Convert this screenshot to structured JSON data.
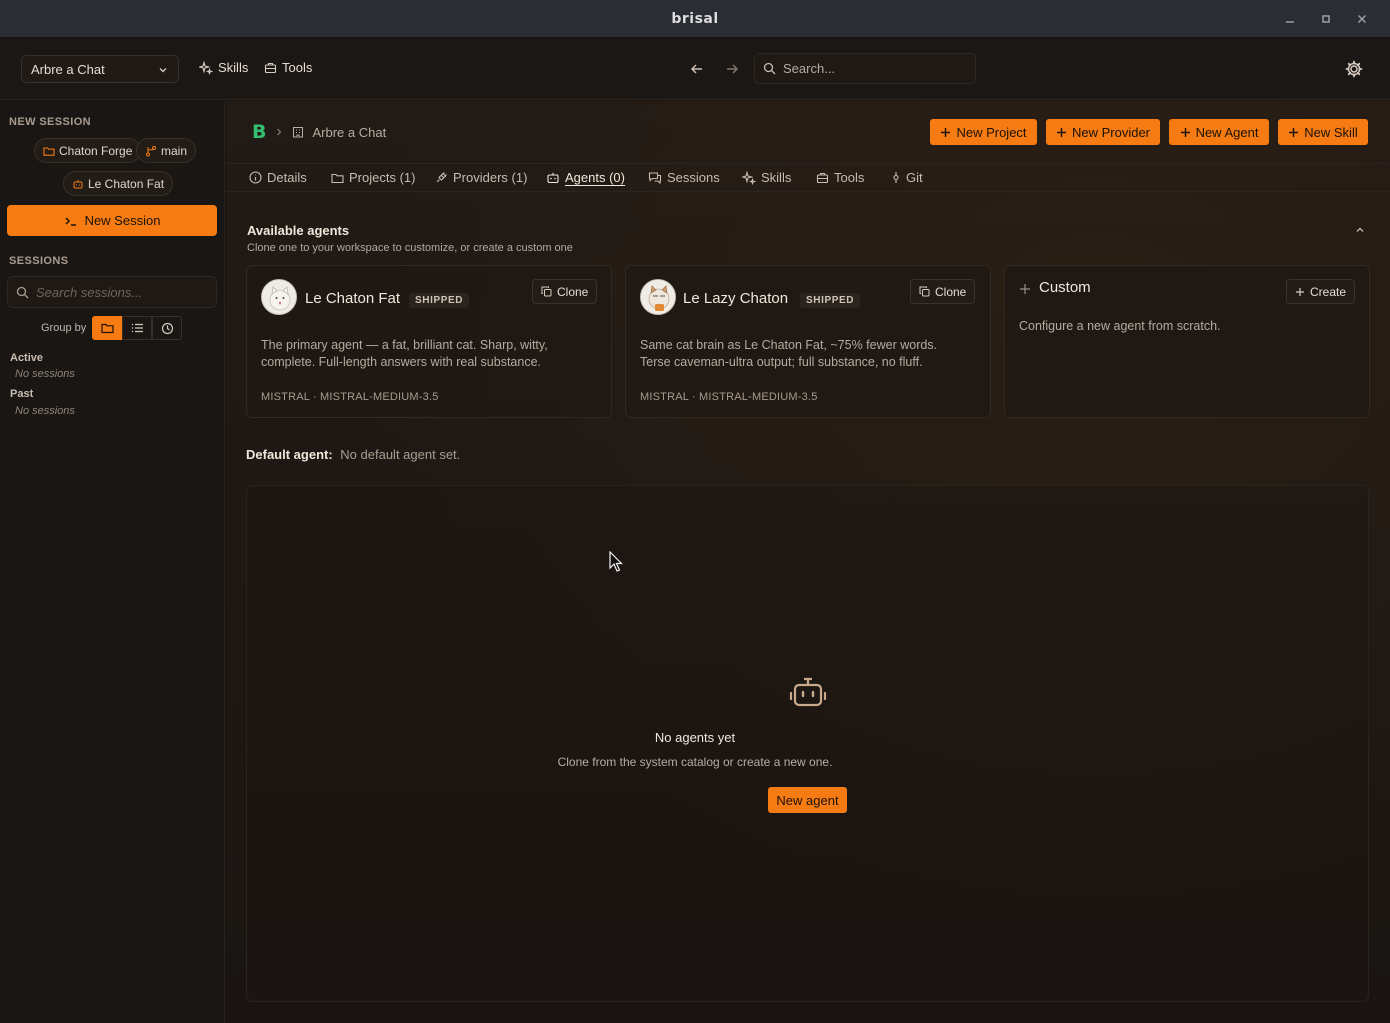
{
  "window": {
    "title": "brisal"
  },
  "header": {
    "workspace": "Arbre a Chat",
    "links": {
      "skills": "Skills",
      "tools": "Tools"
    },
    "search_placeholder": "Search..."
  },
  "sidebar": {
    "new_session_label": "NEW SESSION",
    "chips": {
      "project": "Chaton Forge",
      "branch": "main",
      "agent": "Le Chaton Fat"
    },
    "new_session_button": "New Session",
    "sessions_label": "SESSIONS",
    "search_placeholder": "Search sessions...",
    "group_by": "Group by",
    "groups": [
      {
        "name": "Active",
        "empty": "No sessions"
      },
      {
        "name": "Past",
        "empty": "No sessions"
      }
    ]
  },
  "breadcrumb": {
    "logo": "B",
    "workspace": "Arbre a Chat"
  },
  "actions": {
    "new_project": "New Project",
    "new_provider": "New Provider",
    "new_agent": "New Agent",
    "new_skill": "New Skill"
  },
  "tabs": {
    "details": "Details",
    "projects": "Projects (1)",
    "providers": "Providers (1)",
    "agents": "Agents (0)",
    "sessions": "Sessions",
    "skills": "Skills",
    "tools": "Tools",
    "git": "Git"
  },
  "available": {
    "title": "Available agents",
    "subtitle": "Clone one to your workspace to customize, or create a custom one",
    "cards": [
      {
        "name": "Le Chaton Fat",
        "badge": "SHIPPED",
        "action": "Clone",
        "description": "The primary agent — a fat, brilliant cat. Sharp, witty, complete. Full-length answers with real substance.",
        "meta": "MISTRAL · MISTRAL-MEDIUM-3.5"
      },
      {
        "name": "Le Lazy Chaton",
        "badge": "SHIPPED",
        "action": "Clone",
        "description": "Same cat brain as Le Chaton Fat, ~75% fewer words. Terse caveman-ultra output; full substance, no fluff.",
        "meta": "MISTRAL · MISTRAL-MEDIUM-3.5"
      },
      {
        "name": "Custom",
        "action": "Create",
        "description": "Configure a new agent from scratch."
      }
    ]
  },
  "default_agent": {
    "label": "Default agent:",
    "value": "No default agent set."
  },
  "empty_state": {
    "icon": "robot-icon",
    "title": "No agents yet",
    "subtitle": "Clone from the system catalog or create a new one.",
    "button": "New agent"
  },
  "colors": {
    "accent": "#f57b12",
    "background": "#1a1512",
    "logo": "#33c070"
  }
}
